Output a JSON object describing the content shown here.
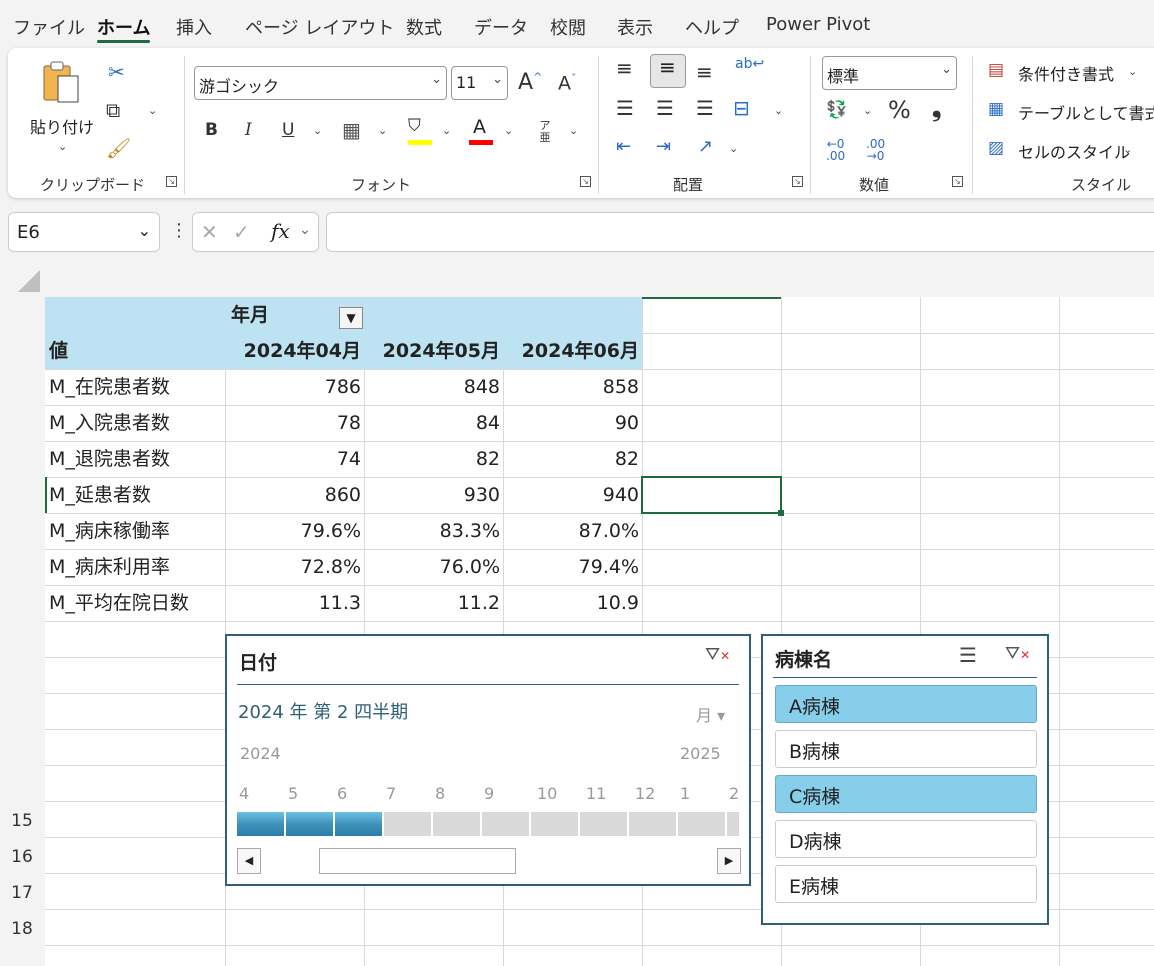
{
  "menu": {
    "tabs": [
      "ファイル",
      "ホーム",
      "挿入",
      "ページ レイアウト",
      "数式",
      "データ",
      "校閲",
      "表示",
      "ヘルプ",
      "Power Pivot"
    ],
    "active": "ホーム"
  },
  "ribbon": {
    "clipboard": {
      "paste": "貼り付け",
      "label": "クリップボード"
    },
    "font": {
      "name": "游ゴシック",
      "size": "11",
      "grow": "A",
      "shrink": "A",
      "bold": "B",
      "italic": "I",
      "underline": "U",
      "furigana": "ア亜",
      "label": "フォント",
      "fill_color": "#ffff00",
      "font_color": "#ff0000"
    },
    "alignment": {
      "label": "配置"
    },
    "number": {
      "format": "標準",
      "percent": "%",
      "comma": "❟",
      "label": "数値"
    },
    "styles": {
      "conditional": "条件付き書式",
      "table": "テーブルとして書式設定",
      "cell_styles": "セルのスタイル",
      "label": "スタイル"
    }
  },
  "formula_bar": {
    "name_box": "E6",
    "fx": "fx",
    "formula": ""
  },
  "pivot": {
    "col_field": "年月",
    "values_label": "値",
    "columns": [
      "2024年04月",
      "2024年05月",
      "2024年06月"
    ],
    "rows": [
      {
        "label": "M_在院患者数",
        "values": [
          "786",
          "848",
          "858"
        ]
      },
      {
        "label": "M_入院患者数",
        "values": [
          "78",
          "84",
          "90"
        ]
      },
      {
        "label": "M_退院患者数",
        "values": [
          "74",
          "82",
          "82"
        ]
      },
      {
        "label": "M_延患者数",
        "values": [
          "860",
          "930",
          "940"
        ]
      },
      {
        "label": "M_病床稼働率",
        "values": [
          "79.6%",
          "83.3%",
          "87.0%"
        ]
      },
      {
        "label": "M_病床利用率",
        "values": [
          "72.8%",
          "76.0%",
          "79.4%"
        ]
      },
      {
        "label": "M_平均在院日数",
        "values": [
          "11.3",
          "11.2",
          "10.9"
        ]
      }
    ]
  },
  "row_headers": [
    "15",
    "16",
    "17",
    "18"
  ],
  "timeline": {
    "title": "日付",
    "period": "2024 年 第 2 四半期",
    "level": "月",
    "year_left": "2024",
    "year_right": "2025",
    "months": [
      "4",
      "5",
      "6",
      "7",
      "8",
      "9",
      "10",
      "11",
      "12",
      "1",
      "2"
    ],
    "selected_months": 3
  },
  "slicer": {
    "title": "病棟名",
    "items": [
      {
        "label": "A病棟",
        "selected": true
      },
      {
        "label": "B病棟",
        "selected": false
      },
      {
        "label": "C病棟",
        "selected": true
      },
      {
        "label": "D病棟",
        "selected": false
      },
      {
        "label": "E病棟",
        "selected": false
      }
    ]
  }
}
